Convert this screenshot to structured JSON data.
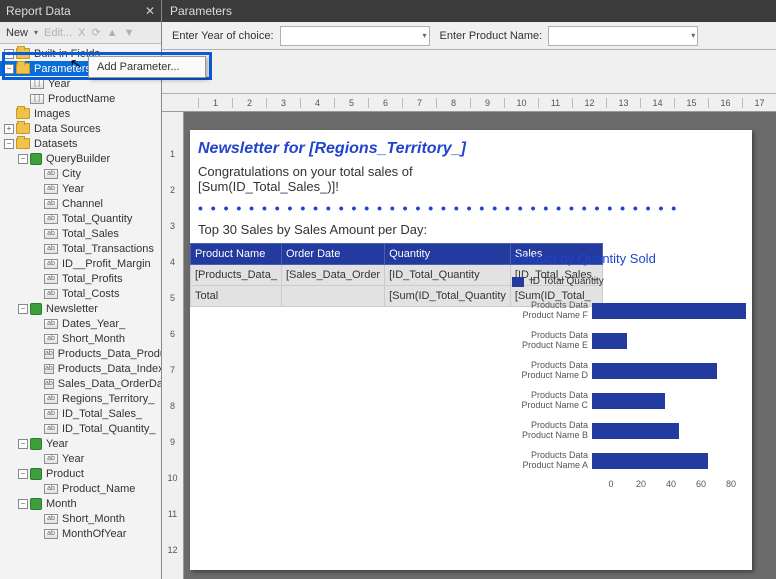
{
  "left_panel": {
    "title": "Report Data",
    "toolbar": {
      "new": "New",
      "edit": "Edit...",
      "delete_icon": "X",
      "refresh_icon": "⟳",
      "up_icon": "▲",
      "down_icon": "▼"
    },
    "tree": {
      "built_in_fields": "Built-in Fields",
      "parameters": "Parameters",
      "param_items": [
        "Year",
        "ProductName"
      ],
      "images": "Images",
      "data_sources": "Data Sources",
      "datasets": "Datasets",
      "query_builder": "QueryBuilder",
      "qb_fields": [
        "City",
        "Year",
        "Channel",
        "Total_Quantity",
        "Total_Sales",
        "Total_Transactions",
        "ID__Profit_Margin",
        "Total_Profits",
        "Total_Costs"
      ],
      "newsletter": "Newsletter",
      "nl_fields": [
        "Dates_Year_",
        "Short_Month",
        "Products_Data_ProductName_",
        "Products_Data_Index_",
        "Sales_Data_OrderDate_",
        "Regions_Territory_",
        "ID_Total_Sales_",
        "ID_Total_Quantity_"
      ],
      "ds_year": "Year",
      "ds_year_fields": [
        "Year"
      ],
      "ds_product": "Product",
      "ds_product_fields": [
        "Product_Name"
      ],
      "ds_month": "Month",
      "ds_month_fields": [
        "Short_Month",
        "MonthOfYear"
      ]
    },
    "context_menu_item": "Add Parameter..."
  },
  "parameters_pane": {
    "title": "Parameters",
    "label1": "Enter Year of choice:",
    "label2": "Enter Product Name:"
  },
  "ruler": {
    "h": [
      "1",
      "2",
      "3",
      "4",
      "5",
      "6",
      "7",
      "8",
      "9",
      "10",
      "11",
      "12",
      "13",
      "14",
      "15",
      "16",
      "17"
    ],
    "v": [
      "1",
      "2",
      "3",
      "4",
      "5",
      "6",
      "7",
      "8",
      "9",
      "10",
      "11",
      "12"
    ]
  },
  "report": {
    "title": "Newsletter for [Regions_Territory_]",
    "congrats_line1": "Congratulations on your total sales of",
    "congrats_line2": "[Sum(ID_Total_Sales_)]!",
    "top30": "Top 30 Sales by Sales Amount per Day:",
    "table": {
      "headers": [
        "Product Name",
        "Order Date",
        "Quantity",
        "Sales"
      ],
      "row1": [
        "[Products_Data_",
        "[Sales_Data_Order",
        "[ID_Total_Quantity",
        "[ID_Total_Sales_"
      ],
      "row2": [
        "Total",
        "",
        "[Sum(ID_Total_Quantity",
        "[Sum(ID_Total_"
      ]
    },
    "chart": {
      "title": "Product by Quantity Sold",
      "legend": "ID Total Quantity"
    }
  },
  "chart_data": {
    "type": "bar",
    "orientation": "horizontal",
    "title": "Product by Quantity Sold",
    "xlabel": "",
    "ylabel": "",
    "xlim": [
      0,
      80
    ],
    "categories": [
      "Products Data Product Name F",
      "Products Data Product Name E",
      "Products Data Product Name D",
      "Products Data Product Name C",
      "Products Data Product Name B",
      "Products Data Product Name A"
    ],
    "values": [
      80,
      18,
      65,
      38,
      45,
      60
    ],
    "axis_ticks": [
      "0",
      "20",
      "40",
      "60",
      "80"
    ],
    "series_name": "ID Total Quantity",
    "color": "#233b9e"
  }
}
